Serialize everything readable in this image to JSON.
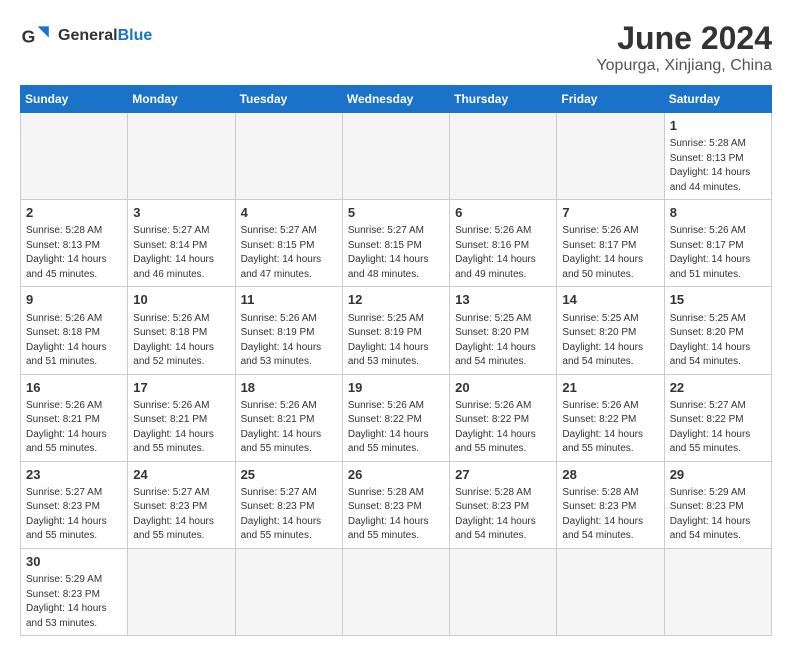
{
  "header": {
    "logo_general": "General",
    "logo_blue": "Blue",
    "month_title": "June 2024",
    "location": "Yopurga, Xinjiang, China"
  },
  "weekdays": [
    "Sunday",
    "Monday",
    "Tuesday",
    "Wednesday",
    "Thursday",
    "Friday",
    "Saturday"
  ],
  "weeks": [
    [
      {
        "day": "",
        "info": ""
      },
      {
        "day": "",
        "info": ""
      },
      {
        "day": "",
        "info": ""
      },
      {
        "day": "",
        "info": ""
      },
      {
        "day": "",
        "info": ""
      },
      {
        "day": "",
        "info": ""
      },
      {
        "day": "1",
        "info": "Sunrise: 5:28 AM\nSunset: 8:13 PM\nDaylight: 14 hours\nand 44 minutes."
      }
    ],
    [
      {
        "day": "2",
        "info": "Sunrise: 5:28 AM\nSunset: 8:13 PM\nDaylight: 14 hours\nand 45 minutes."
      },
      {
        "day": "3",
        "info": "Sunrise: 5:27 AM\nSunset: 8:14 PM\nDaylight: 14 hours\nand 46 minutes."
      },
      {
        "day": "4",
        "info": "Sunrise: 5:27 AM\nSunset: 8:15 PM\nDaylight: 14 hours\nand 47 minutes."
      },
      {
        "day": "5",
        "info": "Sunrise: 5:27 AM\nSunset: 8:15 PM\nDaylight: 14 hours\nand 48 minutes."
      },
      {
        "day": "6",
        "info": "Sunrise: 5:26 AM\nSunset: 8:16 PM\nDaylight: 14 hours\nand 49 minutes."
      },
      {
        "day": "7",
        "info": "Sunrise: 5:26 AM\nSunset: 8:17 PM\nDaylight: 14 hours\nand 50 minutes."
      },
      {
        "day": "8",
        "info": "Sunrise: 5:26 AM\nSunset: 8:17 PM\nDaylight: 14 hours\nand 51 minutes."
      }
    ],
    [
      {
        "day": "9",
        "info": "Sunrise: 5:26 AM\nSunset: 8:18 PM\nDaylight: 14 hours\nand 51 minutes."
      },
      {
        "day": "10",
        "info": "Sunrise: 5:26 AM\nSunset: 8:18 PM\nDaylight: 14 hours\nand 52 minutes."
      },
      {
        "day": "11",
        "info": "Sunrise: 5:26 AM\nSunset: 8:19 PM\nDaylight: 14 hours\nand 53 minutes."
      },
      {
        "day": "12",
        "info": "Sunrise: 5:25 AM\nSunset: 8:19 PM\nDaylight: 14 hours\nand 53 minutes."
      },
      {
        "day": "13",
        "info": "Sunrise: 5:25 AM\nSunset: 8:20 PM\nDaylight: 14 hours\nand 54 minutes."
      },
      {
        "day": "14",
        "info": "Sunrise: 5:25 AM\nSunset: 8:20 PM\nDaylight: 14 hours\nand 54 minutes."
      },
      {
        "day": "15",
        "info": "Sunrise: 5:25 AM\nSunset: 8:20 PM\nDaylight: 14 hours\nand 54 minutes."
      }
    ],
    [
      {
        "day": "16",
        "info": "Sunrise: 5:26 AM\nSunset: 8:21 PM\nDaylight: 14 hours\nand 55 minutes."
      },
      {
        "day": "17",
        "info": "Sunrise: 5:26 AM\nSunset: 8:21 PM\nDaylight: 14 hours\nand 55 minutes."
      },
      {
        "day": "18",
        "info": "Sunrise: 5:26 AM\nSunset: 8:21 PM\nDaylight: 14 hours\nand 55 minutes."
      },
      {
        "day": "19",
        "info": "Sunrise: 5:26 AM\nSunset: 8:22 PM\nDaylight: 14 hours\nand 55 minutes."
      },
      {
        "day": "20",
        "info": "Sunrise: 5:26 AM\nSunset: 8:22 PM\nDaylight: 14 hours\nand 55 minutes."
      },
      {
        "day": "21",
        "info": "Sunrise: 5:26 AM\nSunset: 8:22 PM\nDaylight: 14 hours\nand 55 minutes."
      },
      {
        "day": "22",
        "info": "Sunrise: 5:27 AM\nSunset: 8:22 PM\nDaylight: 14 hours\nand 55 minutes."
      }
    ],
    [
      {
        "day": "23",
        "info": "Sunrise: 5:27 AM\nSunset: 8:23 PM\nDaylight: 14 hours\nand 55 minutes."
      },
      {
        "day": "24",
        "info": "Sunrise: 5:27 AM\nSunset: 8:23 PM\nDaylight: 14 hours\nand 55 minutes."
      },
      {
        "day": "25",
        "info": "Sunrise: 5:27 AM\nSunset: 8:23 PM\nDaylight: 14 hours\nand 55 minutes."
      },
      {
        "day": "26",
        "info": "Sunrise: 5:28 AM\nSunset: 8:23 PM\nDaylight: 14 hours\nand 55 minutes."
      },
      {
        "day": "27",
        "info": "Sunrise: 5:28 AM\nSunset: 8:23 PM\nDaylight: 14 hours\nand 54 minutes."
      },
      {
        "day": "28",
        "info": "Sunrise: 5:28 AM\nSunset: 8:23 PM\nDaylight: 14 hours\nand 54 minutes."
      },
      {
        "day": "29",
        "info": "Sunrise: 5:29 AM\nSunset: 8:23 PM\nDaylight: 14 hours\nand 54 minutes."
      }
    ],
    [
      {
        "day": "30",
        "info": "Sunrise: 5:29 AM\nSunset: 8:23 PM\nDaylight: 14 hours\nand 53 minutes."
      },
      {
        "day": "",
        "info": ""
      },
      {
        "day": "",
        "info": ""
      },
      {
        "day": "",
        "info": ""
      },
      {
        "day": "",
        "info": ""
      },
      {
        "day": "",
        "info": ""
      },
      {
        "day": "",
        "info": ""
      }
    ]
  ]
}
